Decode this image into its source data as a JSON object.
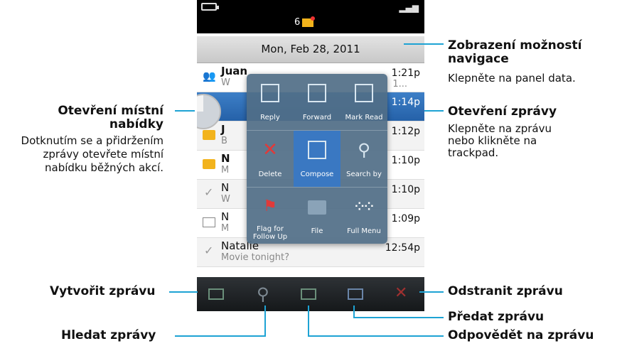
{
  "phone": {
    "status": {
      "notification_count": "6"
    },
    "date_bar": "Mon, Feb 28, 2011",
    "messages": [
      {
        "name": "Juan",
        "preview": "W",
        "time": "1:21p",
        "extra": "1..."
      },
      {
        "name": "",
        "preview": "",
        "time": "1:14p"
      },
      {
        "name": "J",
        "preview": "B",
        "time": "1:12p"
      },
      {
        "name": "N",
        "preview": "M",
        "time": "1:10p"
      },
      {
        "name": "N",
        "preview": "W",
        "time": "1:10p"
      },
      {
        "name": "N",
        "preview": "M",
        "time": "1:09p"
      },
      {
        "name": "Natalie",
        "preview": "Movie tonight?",
        "time": "12:54p"
      }
    ],
    "menu": [
      {
        "label": "Reply",
        "icon": "reply-icon"
      },
      {
        "label": "Forward",
        "icon": "forward-icon"
      },
      {
        "label": "Mark Read",
        "icon": "mark-read-icon"
      },
      {
        "label": "Delete",
        "icon": "delete-icon"
      },
      {
        "label": "Compose",
        "icon": "compose-icon"
      },
      {
        "label": "Search by",
        "icon": "search-icon"
      },
      {
        "label": "Flag for Follow Up",
        "icon": "flag-icon"
      },
      {
        "label": "File",
        "icon": "folder-icon"
      },
      {
        "label": "Full Menu",
        "icon": "blackberry-icon"
      }
    ],
    "toolbar": [
      "compose-icon",
      "search-icon",
      "reply-icon",
      "forward-icon",
      "delete-icon"
    ]
  },
  "callouts": {
    "nav_title": "Zobrazení možností navigace",
    "nav_desc": "Klepněte na panel data.",
    "open_title": "Otevření zprávy",
    "open_desc": "Klepněte na zprávu nebo klikněte na trackpad.",
    "menu_title": "Otevření místní nabídky",
    "menu_desc": "Dotknutím se a přidržením zprávy otevřete místní nabídku běžných akcí.",
    "compose": "Vytvořit zprávu",
    "search": "Hledat zprávy",
    "delete": "Odstranit zprávu",
    "forward": "Předat zprávu",
    "reply": "Odpovědět na zprávu"
  },
  "colors": {
    "accent": "#1ea3d4",
    "selected": "#2d6db5"
  }
}
